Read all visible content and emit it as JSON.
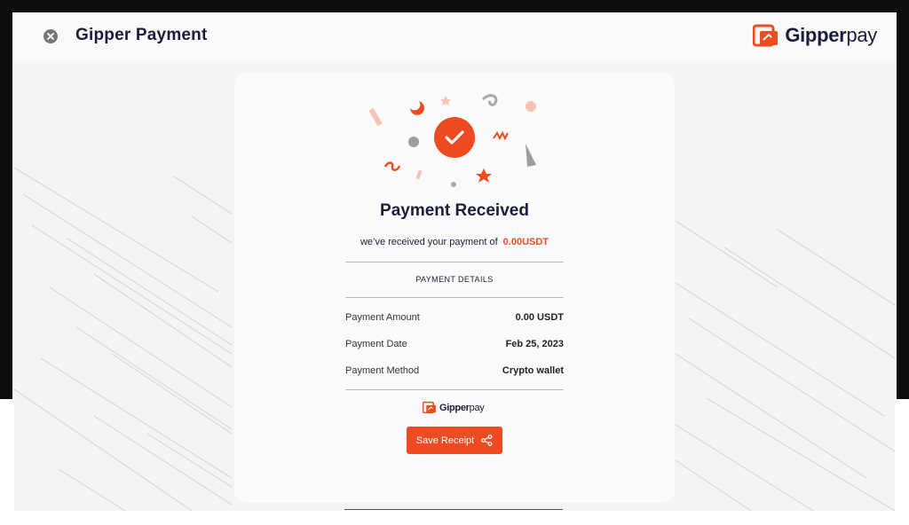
{
  "header": {
    "title": "Gipper Payment",
    "brand_primary": "Gipper",
    "brand_secondary": "pay"
  },
  "card": {
    "title": "Payment Received",
    "subtitle_prefix": "we’ve received your payment of",
    "subtitle_amount": "0.00USDT",
    "details_label": "PAYMENT DETAILS",
    "rows": [
      {
        "label": "Payment Amount",
        "value": "0.00 USDT"
      },
      {
        "label": "Payment Date",
        "value": "Feb 25, 2023"
      },
      {
        "label": "Payment Method",
        "value": "Crypto wallet"
      }
    ],
    "mini_brand_primary": "Gipper",
    "mini_brand_secondary": "pay",
    "save_label": "Save Receipt"
  },
  "icons": {
    "close": "close-icon",
    "logo": "gipperpay-logo-icon",
    "success": "check-circle-icon",
    "share": "share-icon"
  },
  "colors": {
    "accent": "#ee4b22",
    "text_dark": "#1c1c3c",
    "background": "#f4f4f4"
  }
}
